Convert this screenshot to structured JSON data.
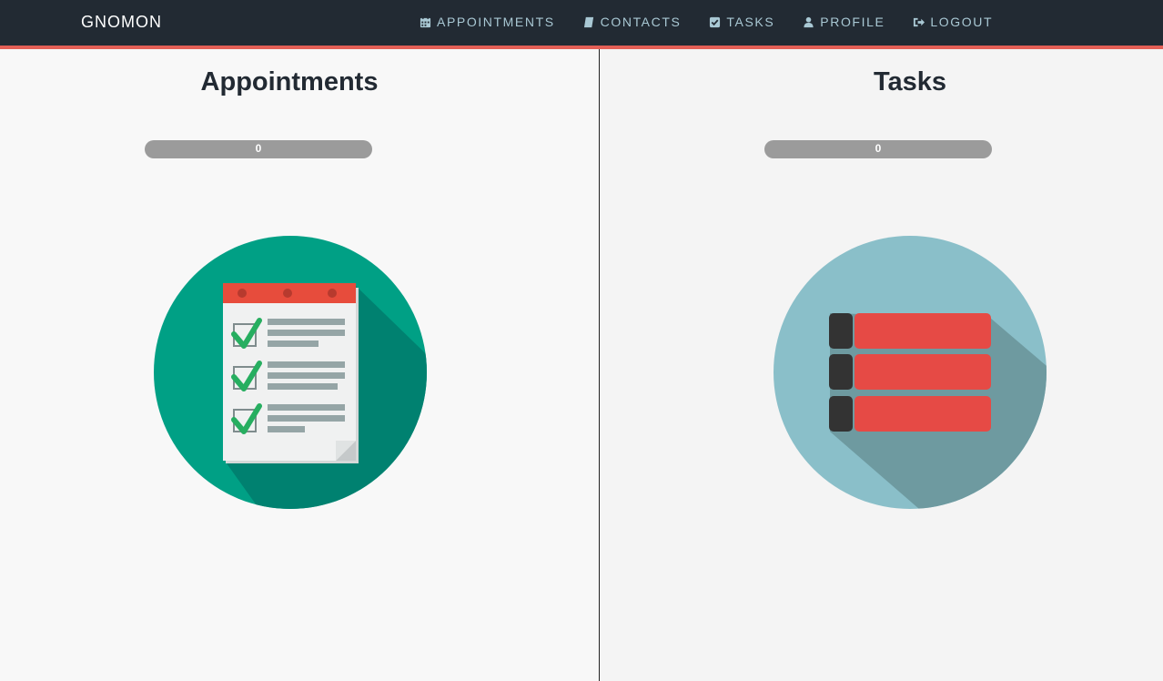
{
  "navbar": {
    "brand": "GNOMON",
    "items": [
      {
        "label": "APPOINTMENTS",
        "icon": "calendar-icon"
      },
      {
        "label": "CONTACTS",
        "icon": "book-icon"
      },
      {
        "label": "TASKS",
        "icon": "check-square-icon"
      },
      {
        "label": "PROFILE",
        "icon": "user-icon"
      },
      {
        "label": "LOGOUT",
        "icon": "logout-icon"
      }
    ],
    "colors": {
      "background": "#222a33",
      "accent_border": "#e45f56",
      "link": "#a9c8d4"
    }
  },
  "panels": {
    "appointments": {
      "title": "Appointments",
      "count": "0",
      "progress_fraction": 0,
      "icon": "checklist-notepad-icon",
      "colors": {
        "circle": "#00a085",
        "shadow": "#008170"
      }
    },
    "tasks": {
      "title": "Tasks",
      "count": "0",
      "progress_fraction": 0,
      "icon": "task-list-icon",
      "colors": {
        "circle": "#8abfc9",
        "shadow": "#6e9aa0",
        "bar": "#e64a45"
      }
    }
  }
}
